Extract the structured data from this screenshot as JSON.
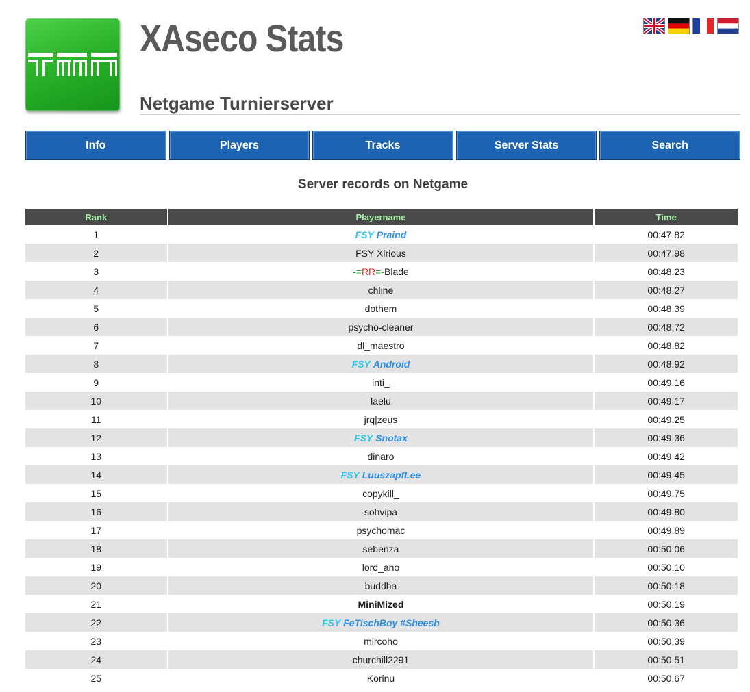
{
  "header": {
    "site_title": "XAseco Stats",
    "server_name": "Netgame Turnierserver",
    "logo_text": "TMN",
    "flags": [
      "flag-uk",
      "flag-de",
      "flag-fr",
      "flag-nl"
    ]
  },
  "nav": [
    {
      "label": "Info"
    },
    {
      "label": "Players"
    },
    {
      "label": "Tracks"
    },
    {
      "label": "Server Stats"
    },
    {
      "label": "Search"
    }
  ],
  "records": {
    "heading": "Server records on Netgame",
    "columns": [
      "Rank",
      "Playername",
      "Time"
    ],
    "rows": [
      {
        "rank": "1",
        "name": "FSY Praind",
        "tag": "FSY",
        "nick": "Praind",
        "time": "00:47.82"
      },
      {
        "rank": "2",
        "name": "FSY Xirious",
        "time": "00:47.98"
      },
      {
        "rank": "3",
        "name": "-=RR=-Blade",
        "parts": [
          "-=",
          "RR",
          "=-",
          "Blade"
        ],
        "time": "00:48.23"
      },
      {
        "rank": "4",
        "name": "chline",
        "time": "00:48.27"
      },
      {
        "rank": "5",
        "name": "dothem",
        "time": "00:48.39"
      },
      {
        "rank": "6",
        "name": "psycho-cleaner",
        "time": "00:48.72"
      },
      {
        "rank": "7",
        "name": "dl_maestro",
        "time": "00:48.82"
      },
      {
        "rank": "8",
        "name": "FSY Android",
        "tag": "FSY",
        "nick": "Android",
        "time": "00:48.92"
      },
      {
        "rank": "9",
        "name": "inti_",
        "time": "00:49.16"
      },
      {
        "rank": "10",
        "name": "laelu",
        "time": "00:49.17"
      },
      {
        "rank": "11",
        "name": "jrq|zeus",
        "time": "00:49.25"
      },
      {
        "rank": "12",
        "name": "FSY Snotax",
        "tag": "FSY",
        "nick": "Snotax",
        "time": "00:49.36"
      },
      {
        "rank": "13",
        "name": "dinaro",
        "time": "00:49.42"
      },
      {
        "rank": "14",
        "name": "FSY LuuszapfLee",
        "tag": "FSY",
        "nick": "LuuszapfLee",
        "time": "00:49.45"
      },
      {
        "rank": "15",
        "name": "copykill_",
        "time": "00:49.75"
      },
      {
        "rank": "16",
        "name": "sohvipa",
        "time": "00:49.80"
      },
      {
        "rank": "17",
        "name": "psychomac",
        "time": "00:49.89"
      },
      {
        "rank": "18",
        "name": "sebenza",
        "time": "00:50.06"
      },
      {
        "rank": "19",
        "name": "lord_ano",
        "time": "00:50.10"
      },
      {
        "rank": "20",
        "name": "buddha",
        "time": "00:50.18"
      },
      {
        "rank": "21",
        "name": "MiniMized",
        "bold": true,
        "time": "00:50.19"
      },
      {
        "rank": "22",
        "name": "FSY FeTischBoy #Sheesh",
        "tag": "FSY",
        "nick": "FeTischBoy #Sheesh",
        "time": "00:50.36"
      },
      {
        "rank": "23",
        "name": "mircoho",
        "time": "00:50.39"
      },
      {
        "rank": "24",
        "name": "churchill2291",
        "time": "00:50.51"
      },
      {
        "rank": "25",
        "name": "Korinu",
        "time": "00:50.67"
      }
    ]
  },
  "colors": {
    "nav_blue": "#1d63b1",
    "header_row": "#4a4a4a",
    "header_text": "#a6f0a6",
    "stripe": "#e3e3e3",
    "fsy_tag": "#29c7f2",
    "fsy_nick": "#2b8fe8",
    "logo_green": "#2bb32a"
  }
}
